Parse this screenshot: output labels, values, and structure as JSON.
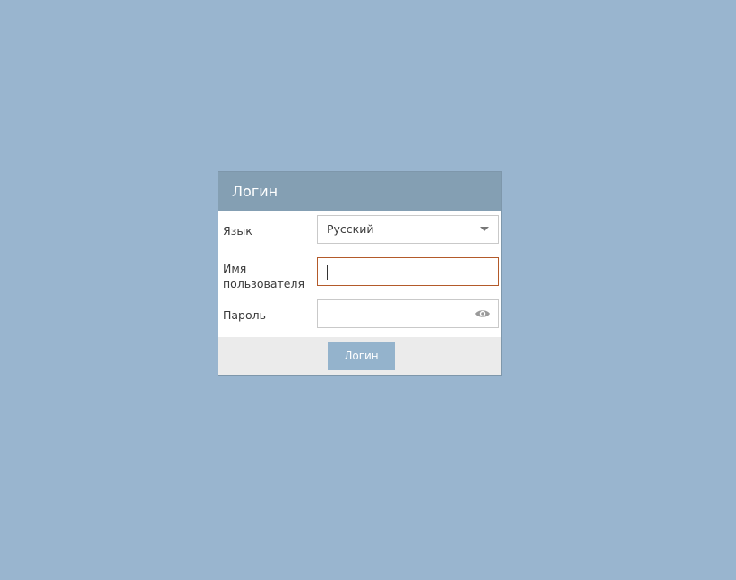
{
  "dialog": {
    "title": "Логин"
  },
  "form": {
    "language_label": "Язык",
    "language_value": "Русский",
    "username_label": "Имя пользователя",
    "username_value": "",
    "password_label": "Пароль",
    "password_value": ""
  },
  "footer": {
    "login_button": "Логин"
  },
  "icons": {
    "dropdown": "chevron-down-icon",
    "password_toggle": "eye-icon"
  },
  "colors": {
    "background": "#99b5cf",
    "header": "#849fb3",
    "focus_border": "#b35a2a",
    "button": "#94b3cc"
  }
}
